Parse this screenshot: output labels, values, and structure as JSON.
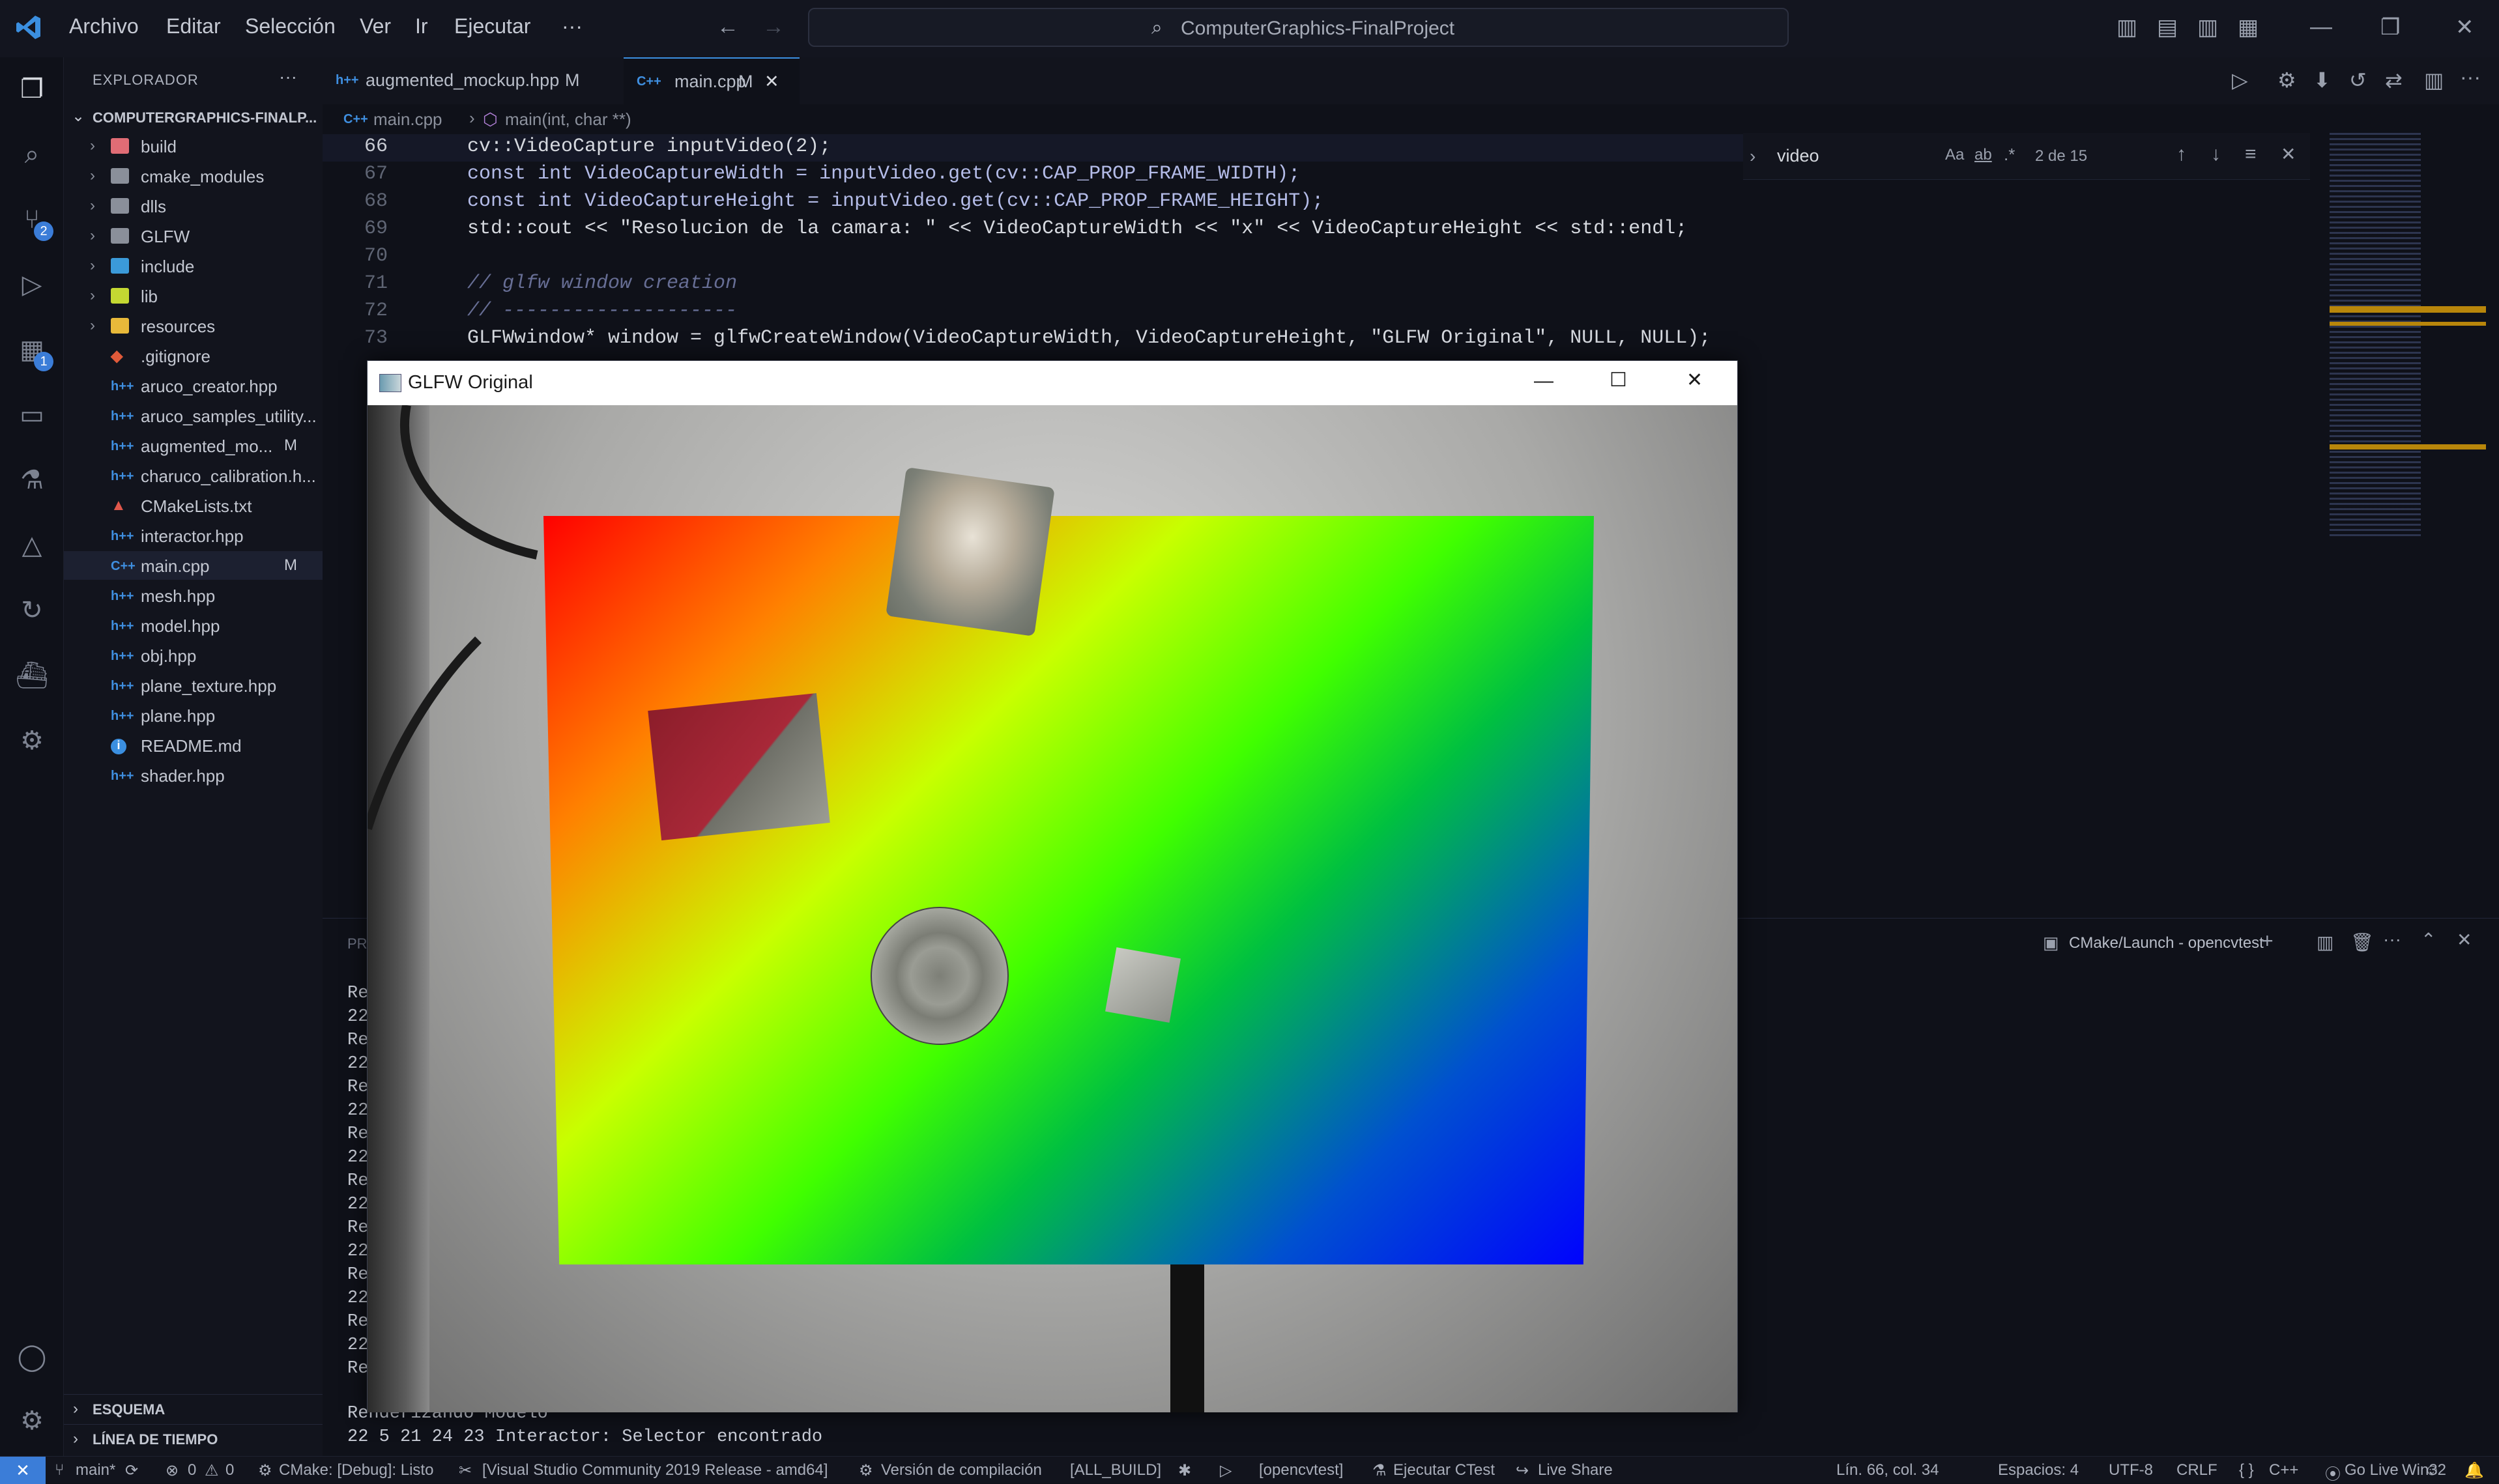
{
  "menu": [
    "Archivo",
    "Editar",
    "Selección",
    "Ver",
    "Ir",
    "Ejecutar",
    "···"
  ],
  "search": {
    "text": "ComputerGraphics-FinalProject"
  },
  "explorer": {
    "title": "EXPLORADOR",
    "root": "COMPUTERGRAPHICS-FINALP...",
    "items": [
      {
        "label": "build",
        "kind": "folder",
        "color": "#e06c75"
      },
      {
        "label": "cmake_modules",
        "kind": "folder",
        "color": "#8a8f9a"
      },
      {
        "label": "dlls",
        "kind": "folder",
        "color": "#8a8f9a"
      },
      {
        "label": "GLFW",
        "kind": "folder",
        "color": "#8a8f9a"
      },
      {
        "label": "include",
        "kind": "folder",
        "color": "#3b9ad9"
      },
      {
        "label": "lib",
        "kind": "folder",
        "color": "#c4d832"
      },
      {
        "label": "resources",
        "kind": "folder",
        "color": "#e8b93a"
      },
      {
        "label": ".gitignore",
        "kind": "file",
        "icon": "◆"
      },
      {
        "label": "aruco_creator.hpp",
        "kind": "file",
        "icon": "h++"
      },
      {
        "label": "aruco_samples_utility...",
        "kind": "file",
        "icon": "h++"
      },
      {
        "label": "augmented_mo...",
        "kind": "file",
        "icon": "h++",
        "mod": "M"
      },
      {
        "label": "charuco_calibration.h...",
        "kind": "file",
        "icon": "h++"
      },
      {
        "label": "CMakeLists.txt",
        "kind": "file",
        "icon": "▲"
      },
      {
        "label": "interactor.hpp",
        "kind": "file",
        "icon": "h++"
      },
      {
        "label": "main.cpp",
        "kind": "file",
        "icon": "C++",
        "mod": "M"
      },
      {
        "label": "mesh.hpp",
        "kind": "file",
        "icon": "h++"
      },
      {
        "label": "model.hpp",
        "kind": "file",
        "icon": "h++"
      },
      {
        "label": "obj.hpp",
        "kind": "file",
        "icon": "h++"
      },
      {
        "label": "plane_texture.hpp",
        "kind": "file",
        "icon": "h++"
      },
      {
        "label": "plane.hpp",
        "kind": "file",
        "icon": "h++"
      },
      {
        "label": "README.md",
        "kind": "file",
        "icon": "i"
      },
      {
        "label": "shader.hpp",
        "kind": "file",
        "icon": "h++"
      }
    ],
    "sections": [
      "ESQUEMA",
      "LÍNEA DE TIEMPO"
    ]
  },
  "tabs": [
    {
      "label": "augmented_mockup.hpp",
      "mod": "M"
    },
    {
      "label": "main.cpp",
      "mod": "M"
    }
  ],
  "breadcrumb": {
    "file": "main.cpp",
    "symbol": "main(int, char **)"
  },
  "code": {
    "line_numbers": [
      "66",
      "67",
      "68",
      "69",
      "70",
      "71",
      "72",
      "73"
    ],
    "lines": [
      "cv::VideoCapture inputVideo(2);",
      "const int VideoCaptureWidth = inputVideo.get(cv::CAP_PROP_FRAME_WIDTH);",
      "const int VideoCaptureHeight = inputVideo.get(cv::CAP_PROP_FRAME_HEIGHT);",
      "std::cout << \"Resolucion de la camara: \" << VideoCaptureWidth << \"x\" << VideoCaptureHeight << std::endl;",
      "",
      "// glfw window creation",
      "// --------------------",
      "GLFWwindow* window = glfwCreateWindow(VideoCaptureWidth, VideoCaptureHeight, \"GLFW Original\", NULL, NULL);"
    ]
  },
  "find": {
    "query": "video",
    "aa": "Aa",
    "ab": "ab",
    "re": ".*",
    "count": "2 de 15"
  },
  "panel": {
    "terminal_name": "CMake/Launch - opencvtest",
    "partial_left": [
      "Re",
      "22",
      "Re",
      "22",
      "Re",
      "22",
      "Re",
      "22",
      "Re",
      "22",
      "Re",
      "22",
      "Re",
      "22",
      "Re",
      "22",
      "Re"
    ],
    "last_lines": [
      "Renderizando Modelo",
      "22 5 21 24 23 Interactor: Selector encontrado"
    ]
  },
  "glfw": {
    "title": "GLFW Original"
  },
  "status": {
    "branch": "main*",
    "errors": "0",
    "warnings": "0",
    "cmake": "CMake: [Debug]: Listo",
    "kit": "[Visual Studio Community 2019 Release - amd64]",
    "build": "Versión de compilación",
    "target": "[ALL_BUILD]",
    "launch": "[opencvtest]",
    "ctest": "Ejecutar CTest",
    "liveshare": "Live Share",
    "pos": "Lín. 66, col. 34",
    "spaces": "Espacios: 4",
    "enc": "UTF-8",
    "eol": "CRLF",
    "lang": "C++",
    "golive": "Go Live",
    "platform": "Win32"
  }
}
